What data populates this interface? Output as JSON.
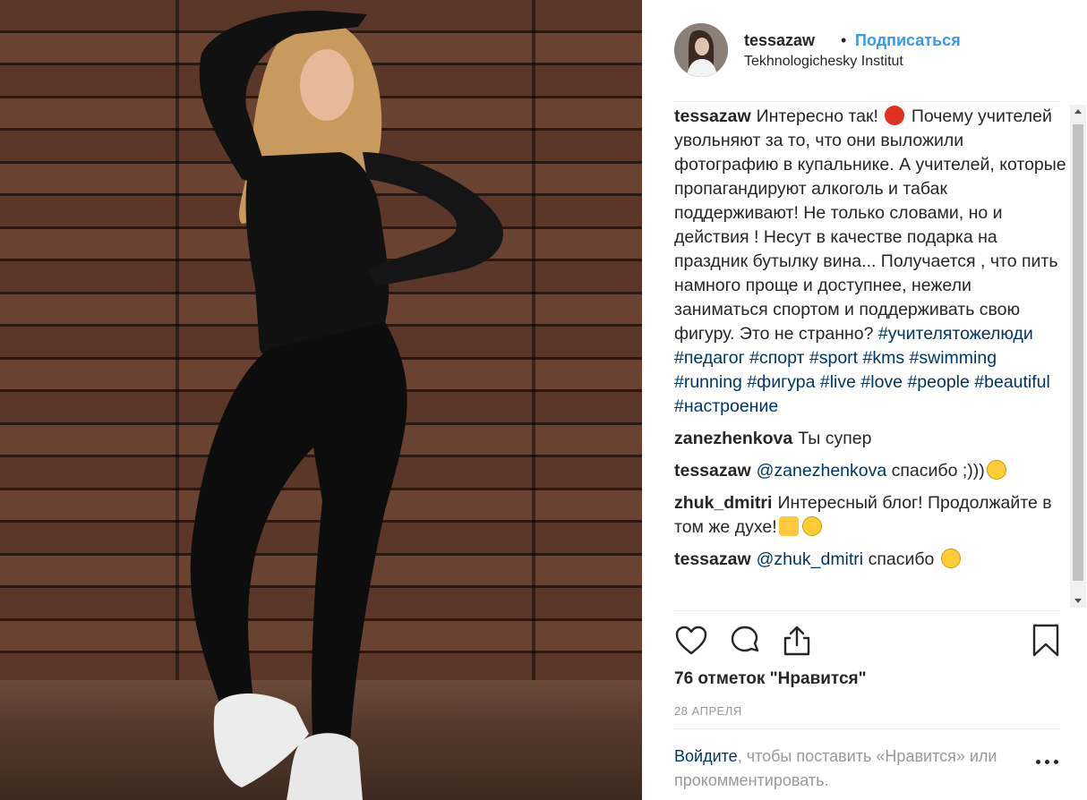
{
  "post": {
    "username": "tessazaw",
    "separator": "•",
    "follow_label": "Подписаться",
    "location": "Tekhnologichesky Institut"
  },
  "caption": {
    "user": "tessazaw",
    "text_1": "Интересно так!",
    "text_2": "Почему учителей увольняют за то, что они выложили фотографию в купальнике. А учителей, которые пропагандируют алкоголь и табак поддерживают! Не только словами, но и действия ! Несут в качестве подарка на праздник бутылку вина... Получается , что пить намного проще и доступнее, нежели заниматься спортом и поддерживать свою фигуру. Это не странно?",
    "hashtags": [
      "#учителятожелюди",
      "#педагог",
      "#спорт",
      "#sport",
      "#kms",
      "#swimming",
      "#running",
      "#фигура",
      "#live",
      "#love",
      "#people",
      "#beautiful",
      "#настроение"
    ]
  },
  "comments": [
    {
      "user": "zanezhenkova",
      "mention": "",
      "text": "Ты супер"
    },
    {
      "user": "tessazaw",
      "mention": "@zanezhenkova",
      "text": "спасибо ;)))"
    },
    {
      "user": "zhuk_dmitri",
      "mention": "",
      "text": "Интересный блог! Продолжайте в том же духе!"
    },
    {
      "user": "tessazaw",
      "mention": "@zhuk_dmitri",
      "text": "спасибо"
    }
  ],
  "likes": "76 отметок \"Нравится\"",
  "date": "28 АПРЕЛЯ",
  "login": {
    "link": "Войдите",
    "text": ", чтобы поставить «Нравится» или прокомментировать."
  },
  "icons": [
    "heart-icon",
    "comment-icon",
    "share-icon",
    "bookmark-icon",
    "more-options-icon"
  ],
  "colors": {
    "link_blue": "#3897f0",
    "hashtag_blue": "#003569",
    "muted": "#999999",
    "text": "#262626"
  }
}
